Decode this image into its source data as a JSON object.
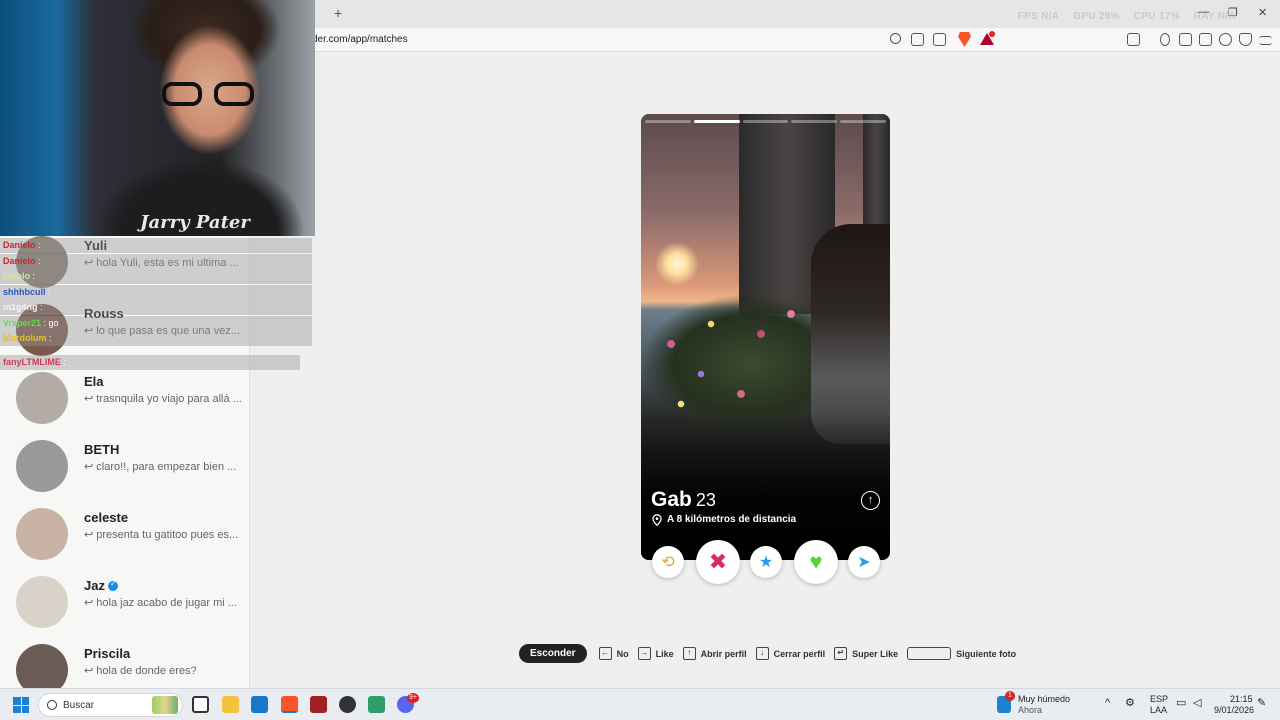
{
  "browser": {
    "new_tab": "+",
    "url": "der.com/app/matches",
    "perf": [
      "FPS N/A",
      "GPU 29%",
      "CPU 17%",
      "RAY N/A"
    ],
    "window_controls": [
      "—",
      "❐",
      "✕"
    ]
  },
  "webcam": {
    "shirt_text": "Jarry Pater"
  },
  "matches": [
    {
      "name": "Yuli",
      "preview": "hola Yuli, esta es mi ultima ...",
      "verified": false
    },
    {
      "name": "Rouss",
      "preview": "lo que pasa es que una vez...",
      "verified": false
    },
    {
      "name": "Ela",
      "preview": "trasnquila yo viajo para allá ...",
      "verified": false
    },
    {
      "name": "BETH",
      "preview": "claro!!, para empezar bien ...",
      "verified": false
    },
    {
      "name": "celeste",
      "preview": "presenta tu gatitoo pues es...",
      "verified": false
    },
    {
      "name": "Jaz",
      "preview": "hola jaz acabo de jugar mi ...",
      "verified": true
    },
    {
      "name": "Priscila",
      "preview": "hola de donde eres?",
      "verified": false
    }
  ],
  "reply_glyph": "↩",
  "chat": [
    {
      "user": "Danielo",
      "text": "",
      "color": "#c8262f"
    },
    {
      "user": "Danielo",
      "text": "",
      "color": "#c8262f"
    },
    {
      "user": "fanolo",
      "text": "",
      "color": "#cfe6a0"
    },
    {
      "user": "shhhbcull",
      "text": "",
      "color": "#2b55c9"
    },
    {
      "user": "m1g4ng",
      "text": "",
      "color": "#f3f3f3"
    },
    {
      "user": "Vrxper21",
      "text": "go",
      "color": "#5de34a"
    },
    {
      "user": "Mordolum",
      "text": "",
      "color": "#e3c12a"
    },
    {
      "user": "fanyLTMLIME",
      "text": "",
      "color": "#d23a5c"
    }
  ],
  "profile": {
    "name": "Gab",
    "age": "23",
    "distance": "A 8 kilómetros de distancia",
    "photo_count": 5,
    "current_photo": 2
  },
  "actions": [
    {
      "name": "rewind",
      "glyph": "⟲",
      "color": "#e5a23b"
    },
    {
      "name": "nope",
      "glyph": "✖",
      "color": "#d62a6a"
    },
    {
      "name": "super-like",
      "glyph": "★",
      "color": "#2b9ae5"
    },
    {
      "name": "like",
      "glyph": "♥",
      "color": "#5bd13a"
    },
    {
      "name": "boost",
      "glyph": "➤",
      "color": "#2a9fe0"
    }
  ],
  "hints": {
    "hide": "Esconder",
    "items": [
      {
        "key": "←",
        "label": "No"
      },
      {
        "key": "→",
        "label": "Like"
      },
      {
        "key": "↑",
        "label": "Abrir perfil"
      },
      {
        "key": "↓",
        "label": "Cerrar perfil"
      },
      {
        "key": "↵",
        "label": "Super Like"
      },
      {
        "key": "",
        "label": "Siguiente foto"
      }
    ]
  },
  "taskbar": {
    "search": "Buscar",
    "weather_title": "Muy húmedo",
    "weather_sub": "Ahora",
    "weather_badge": "1",
    "lang": "ESP",
    "lang_sub": "LAA",
    "time": "21:15",
    "date": "9/01/2026",
    "discord_badge": "9+"
  },
  "colors": {
    "accent": "#fd267a",
    "like": "#5bd13a",
    "superlike": "#2b9ae5"
  }
}
